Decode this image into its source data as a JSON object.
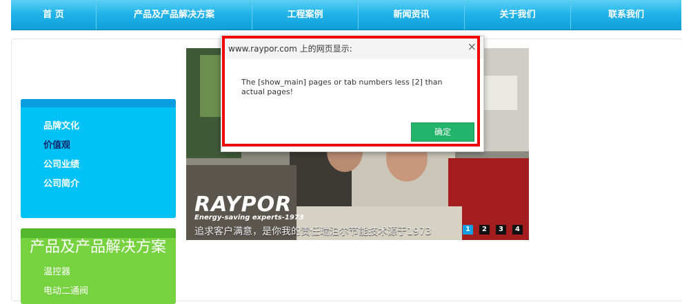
{
  "nav": {
    "items": [
      {
        "label": "首 页"
      },
      {
        "label": "产品及产品解决方案"
      },
      {
        "label": "工程案例"
      },
      {
        "label": "新闻资讯"
      },
      {
        "label": "关于我们"
      },
      {
        "label": "联系我们"
      }
    ]
  },
  "sidebar": {
    "about_items": [
      {
        "label": "品牌文化"
      },
      {
        "label": "价值观"
      },
      {
        "label": "公司业绩"
      },
      {
        "label": "公司简介"
      }
    ],
    "products_title": "产品及产品解决方案",
    "product_items": [
      {
        "label": "温控器"
      },
      {
        "label": "电动二通阀"
      }
    ]
  },
  "banner": {
    "logo_text": "RAYPOR",
    "logo_tagline": "Energy-saving experts-1973",
    "caption": "追求客户满意，是你我的责任瑞泊尔节能技术源于1973",
    "pages": [
      "1",
      "2",
      "3",
      "4"
    ],
    "active_page": "1"
  },
  "dialog": {
    "title": "www.raypor.com 上的网页显示:",
    "close": "×",
    "message": "The [show_main] pages or tab numbers less [2] than actual pages!",
    "ok_label": "确定"
  },
  "colors": {
    "nav": "#1eaee6",
    "blue_box": "#00c2f6",
    "green_box": "#77d23f",
    "ok_button": "#22b46a",
    "highlight": "#ee0000"
  }
}
